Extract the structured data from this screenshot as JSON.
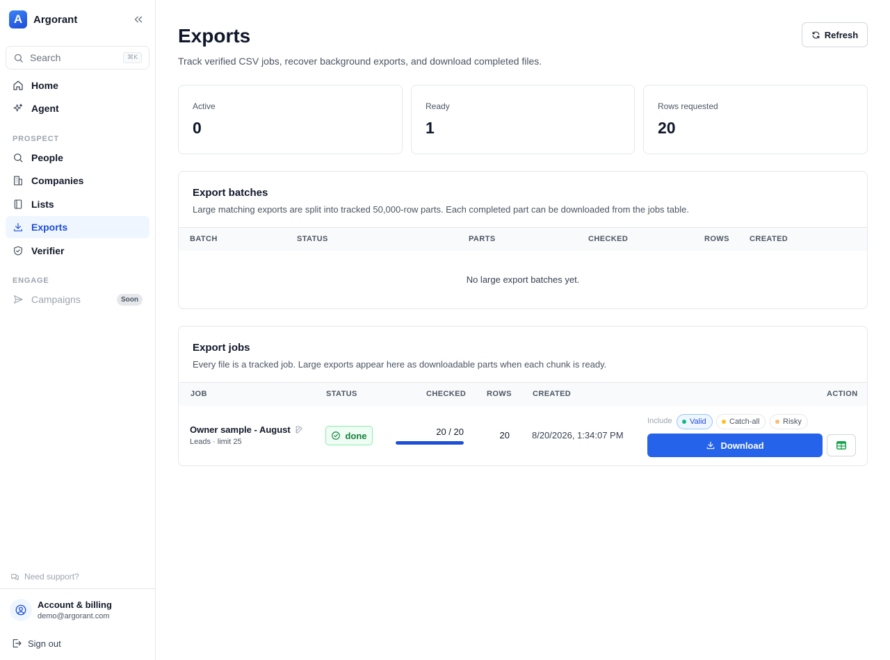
{
  "app": {
    "name": "Argorant"
  },
  "search": {
    "label": "Search",
    "shortcut": "⌘K"
  },
  "nav": {
    "home": "Home",
    "agent": "Agent",
    "prospect_label": "PROSPECT",
    "people": "People",
    "companies": "Companies",
    "lists": "Lists",
    "exports": "Exports",
    "verifier": "Verifier",
    "engage_label": "ENGAGE",
    "campaigns": "Campaigns",
    "campaigns_badge": "Soon",
    "active_item": "exports"
  },
  "footer": {
    "support": "Need support?",
    "account_title": "Account & billing",
    "account_email": "demo@argorant.com",
    "signout": "Sign out"
  },
  "header": {
    "title": "Exports",
    "subtitle": "Track verified CSV jobs, recover background exports, and download completed files.",
    "refresh_label": "Refresh"
  },
  "stats": {
    "active_label": "Active",
    "active_value": "0",
    "ready_label": "Ready",
    "ready_value": "1",
    "rows_label": "Rows requested",
    "rows_value": "20"
  },
  "batches": {
    "title": "Export batches",
    "subtitle": "Large matching exports are split into tracked 50,000-row parts. Each completed part can be downloaded from the jobs table.",
    "columns": [
      "BATCH",
      "STATUS",
      "PARTS",
      "CHECKED",
      "ROWS",
      "CREATED"
    ],
    "empty": "No large export batches yet."
  },
  "jobs": {
    "title": "Export jobs",
    "subtitle": "Every file is a tracked job. Large exports appear here as downloadable parts when each chunk is ready.",
    "columns": [
      "JOB",
      "STATUS",
      "CHECKED",
      "ROWS",
      "CREATED",
      "ACTION"
    ],
    "rows": [
      {
        "name": "Owner sample - August",
        "meta": "Leads · limit 25",
        "status": "done",
        "checked": "20 / 20",
        "checked_fraction": 1.0,
        "rows": "20",
        "created": "8/20/2026, 1:34:07 PM",
        "include_label": "Include",
        "filters": [
          {
            "label": "Valid",
            "color": "#10b981",
            "selected": true
          },
          {
            "label": "Catch-all",
            "color": "#fbbf24",
            "selected": false
          },
          {
            "label": "Risky",
            "color": "#fdba74",
            "selected": false
          }
        ],
        "download_label": "Download"
      }
    ]
  },
  "colors": {
    "accent": "#2563eb",
    "success": "#15803d",
    "active_nav_bg": "#eff6ff"
  }
}
